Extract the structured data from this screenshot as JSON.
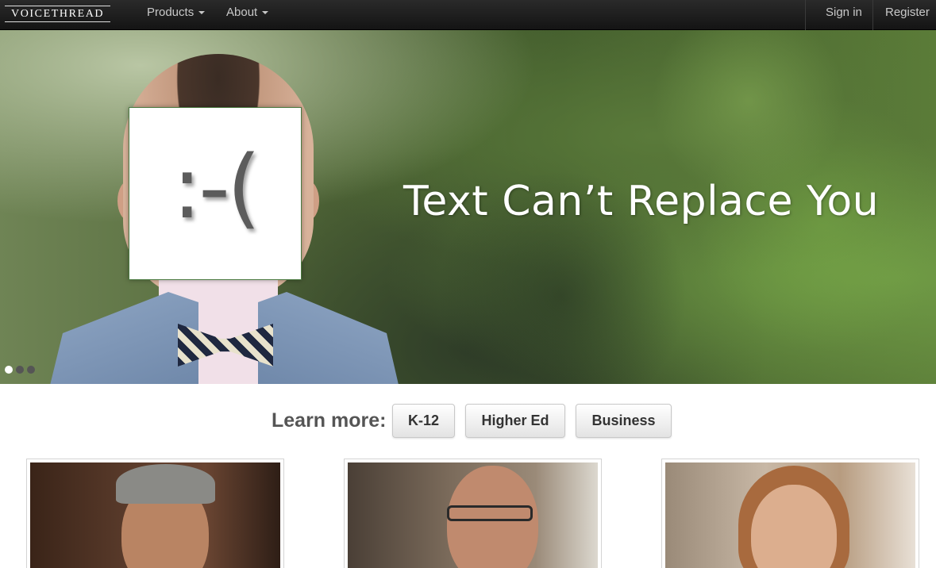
{
  "navbar": {
    "brand": "VOICETHREAD",
    "menus": [
      {
        "label": "Products"
      },
      {
        "label": "About"
      }
    ],
    "sign_in": "Sign in",
    "register": "Register"
  },
  "hero": {
    "emoticon": ":-(",
    "headline": "Text Can’t Replace You",
    "slides_total": 3,
    "active_slide": 1
  },
  "learn_more": {
    "label": "Learn more:",
    "buttons": [
      "K-12",
      "Higher Ed",
      "Business"
    ]
  },
  "colors": {
    "navbar_bg": "#1c1c1c",
    "nav_text": "#c8c8c8",
    "headline_text": "#ffffff",
    "learn_label": "#555555"
  }
}
